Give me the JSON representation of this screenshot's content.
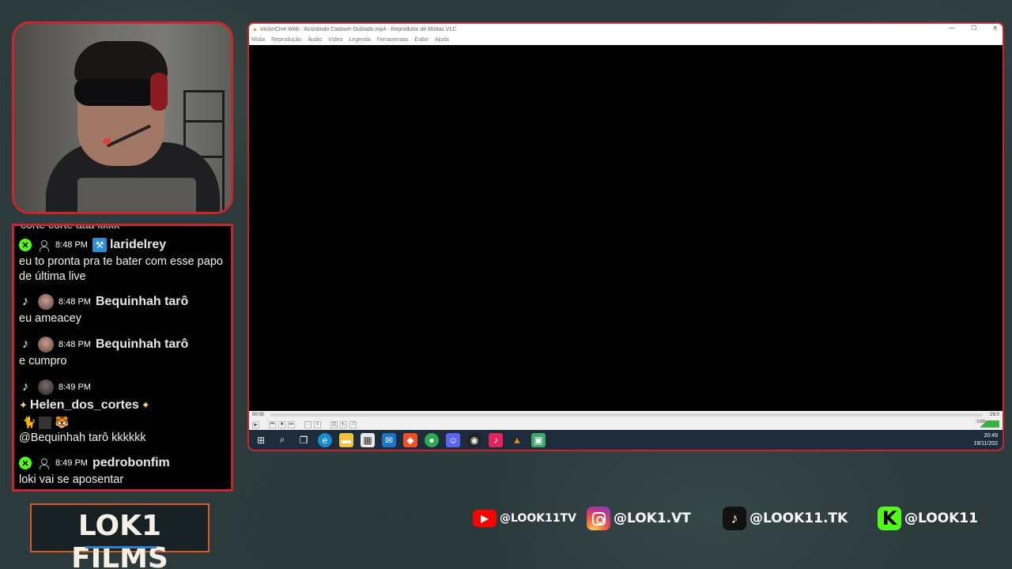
{
  "chat": {
    "cut_text": "corte corte aaa kkkk",
    "messages": [
      {
        "platform": "kick",
        "time": "8:48 PM",
        "user": "laridelrey",
        "text": "eu to pronta pra te bater com esse papo de última live"
      },
      {
        "platform": "tiktok",
        "time": "8:48 PM",
        "user": "Bequinhah tarô",
        "text": "eu ameacey"
      },
      {
        "platform": "tiktok",
        "time": "8:48 PM",
        "user": "Bequinhah tarô",
        "text": "e cumpro"
      },
      {
        "platform": "tiktok",
        "time": "8:49 PM",
        "user": "Helen_dos_cortes",
        "text": "@Bequinhah tarô kkkkkk"
      },
      {
        "platform": "kick",
        "time": "8:49 PM",
        "user": "pedrobonfim",
        "text": "loki vai se aposentar"
      }
    ]
  },
  "logo": {
    "text": "LOK1 FILMS"
  },
  "vlc": {
    "title": "VisionCine Web - Assistindo Cadaver Dublado.mp4 - Reprodutor de Mídias VLC",
    "menu": [
      "Mídia",
      "Reprodução",
      "Áudio",
      "Vídeo",
      "Legenda",
      "Ferramentas",
      "Exibir",
      "Ajuda"
    ],
    "time_elapsed": "00:00",
    "time_total": ":26:0",
    "volume": "100%",
    "clock_time": "20:49",
    "clock_date": "19/11/202"
  },
  "social": [
    {
      "icon": "youtube-icon",
      "handle": "@LOOK11TV"
    },
    {
      "icon": "instagram-icon",
      "handle": "@LOK1.VT"
    },
    {
      "icon": "tiktok-icon",
      "handle": "@LOOK11.TK"
    },
    {
      "icon": "kick-icon",
      "handle": "@LOOK11"
    }
  ],
  "colors": {
    "frame_red": "#c8262c",
    "kick_green": "#53fc18",
    "logo_orange": "#d65a2a"
  }
}
